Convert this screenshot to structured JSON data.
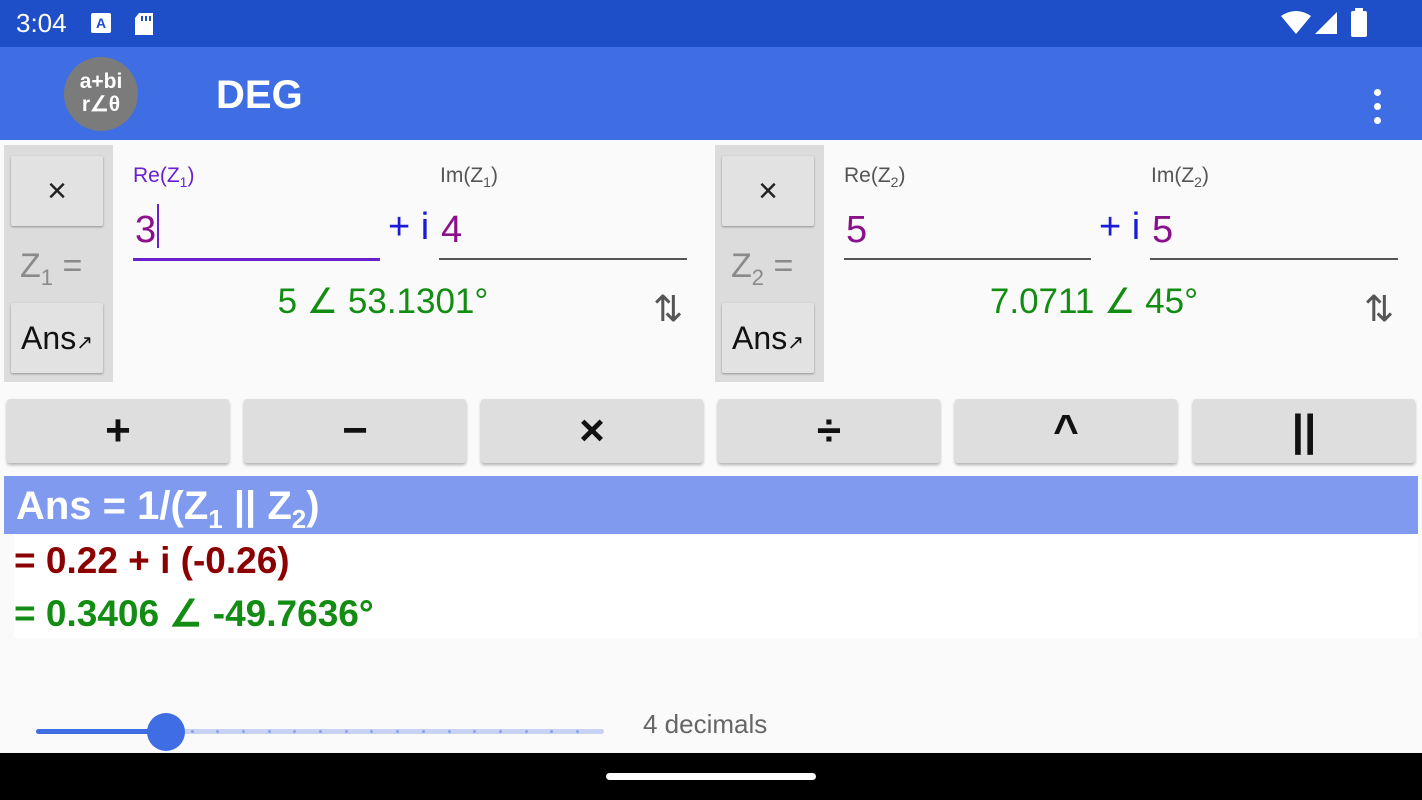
{
  "status_bar": {
    "time": "3:04",
    "icons": [
      "a-notification-icon",
      "sd-card-icon",
      "wifi-icon",
      "cellular-icon",
      "battery-icon"
    ]
  },
  "app_bar": {
    "logo_line1": "a+bi",
    "logo_line2": "r∠θ",
    "angle_mode": "DEG",
    "menu_icon": "more-vert-icon"
  },
  "z1": {
    "clear_label": "×",
    "label_main": "Z",
    "label_sub": "1",
    "label_eq": " =",
    "ans_label": "Ans",
    "ans_arrow": "↗",
    "re_label_prefix": "Re(Z",
    "re_label_sub": "1",
    "re_label_suffix": ")",
    "im_label_prefix": "Im(Z",
    "im_label_sub": "1",
    "im_label_suffix": ")",
    "re_value": "3",
    "plus_i": "+ i",
    "im_value": "4",
    "polar": "5 ∠ 53.1301°",
    "swap_icon": "⇅"
  },
  "z2": {
    "clear_label": "×",
    "label_main": "Z",
    "label_sub": "2",
    "label_eq": " =",
    "ans_label": "Ans",
    "ans_arrow": "↗",
    "re_label_prefix": "Re(Z",
    "re_label_sub": "2",
    "re_label_suffix": ")",
    "im_label_prefix": "Im(Z",
    "im_label_sub": "2",
    "im_label_suffix": ")",
    "re_value": "5",
    "plus_i": "+ i",
    "im_value": "5",
    "polar": "7.0711 ∠ 45°",
    "swap_icon": "⇅"
  },
  "operators": [
    "+",
    "−",
    "×",
    "÷",
    "^",
    "||"
  ],
  "result": {
    "header_prefix": "Ans = 1/(Z",
    "header_sub1": "1",
    "header_mid": " || Z",
    "header_sub2": "2",
    "header_suffix": ")",
    "rect": "= 0.22 + i (-0.26)",
    "polar": "= 0.3406 ∠ -49.7636°"
  },
  "decimals": {
    "label": "4 decimals",
    "value": 4,
    "min": 0,
    "max": 20
  },
  "colors": {
    "status_bar": "#1f4ec9",
    "app_bar": "#3f6de3",
    "result_header": "#7f9aee",
    "rect_result": "#8b0000",
    "polar_result": "#128c12",
    "input_value": "#8b108b",
    "active_field": "#6a1fd1"
  }
}
